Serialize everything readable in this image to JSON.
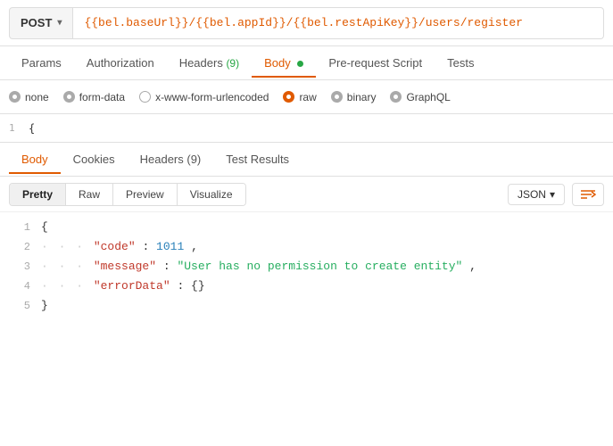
{
  "method": {
    "label": "POST",
    "chevron": "▾"
  },
  "url": "{{bel.baseUrl}}/{{bel.appId}}/{{bel.restApiKey}}/users/register",
  "tabs_top": [
    {
      "id": "params",
      "label": "Params",
      "badge": null,
      "dot": null,
      "active": false
    },
    {
      "id": "authorization",
      "label": "Authorization",
      "badge": null,
      "dot": null,
      "active": false
    },
    {
      "id": "headers",
      "label": "Headers",
      "badge": "(9)",
      "dot": null,
      "active": false
    },
    {
      "id": "body",
      "label": "Body",
      "badge": null,
      "dot": "green",
      "active": true
    },
    {
      "id": "pre-request",
      "label": "Pre-request Script",
      "badge": null,
      "dot": null,
      "active": false
    },
    {
      "id": "tests",
      "label": "Tests",
      "badge": null,
      "dot": null,
      "active": false
    }
  ],
  "radio_options": [
    {
      "id": "none",
      "label": "none",
      "state": "gray"
    },
    {
      "id": "form-data",
      "label": "form-data",
      "state": "gray"
    },
    {
      "id": "urlencoded",
      "label": "x-www-form-urlencoded",
      "state": "gray"
    },
    {
      "id": "raw",
      "label": "raw",
      "state": "orange"
    },
    {
      "id": "binary",
      "label": "binary",
      "state": "gray"
    },
    {
      "id": "graphql",
      "label": "GraphQL",
      "state": "gray"
    }
  ],
  "input_line": "{",
  "result_tabs": [
    {
      "id": "body",
      "label": "Body",
      "active": true
    },
    {
      "id": "cookies",
      "label": "Cookies",
      "active": false
    },
    {
      "id": "headers",
      "label": "Headers (9)",
      "active": false
    },
    {
      "id": "test-results",
      "label": "Test Results",
      "active": false
    }
  ],
  "format_buttons": [
    {
      "id": "pretty",
      "label": "Pretty",
      "active": true
    },
    {
      "id": "raw",
      "label": "Raw",
      "active": false
    },
    {
      "id": "preview",
      "label": "Preview",
      "active": false
    },
    {
      "id": "visualize",
      "label": "Visualize",
      "active": false
    }
  ],
  "json_type": "JSON",
  "json_lines": [
    {
      "num": 1,
      "indent": 0,
      "content_type": "brace",
      "text": "{"
    },
    {
      "num": 2,
      "indent": 1,
      "content_type": "key-num",
      "key": "\"code\"",
      "colon": ": ",
      "value": "1011",
      "comma": ","
    },
    {
      "num": 3,
      "indent": 1,
      "content_type": "key-str",
      "key": "\"message\"",
      "colon": ": ",
      "value": "\"User has no permission to create entity\"",
      "comma": ","
    },
    {
      "num": 4,
      "indent": 1,
      "content_type": "key-obj",
      "key": "\"errorData\"",
      "colon": ": ",
      "value": "{}",
      "comma": ""
    },
    {
      "num": 5,
      "indent": 0,
      "content_type": "brace",
      "text": "}"
    }
  ],
  "icons": {
    "wrap": "⇌"
  }
}
